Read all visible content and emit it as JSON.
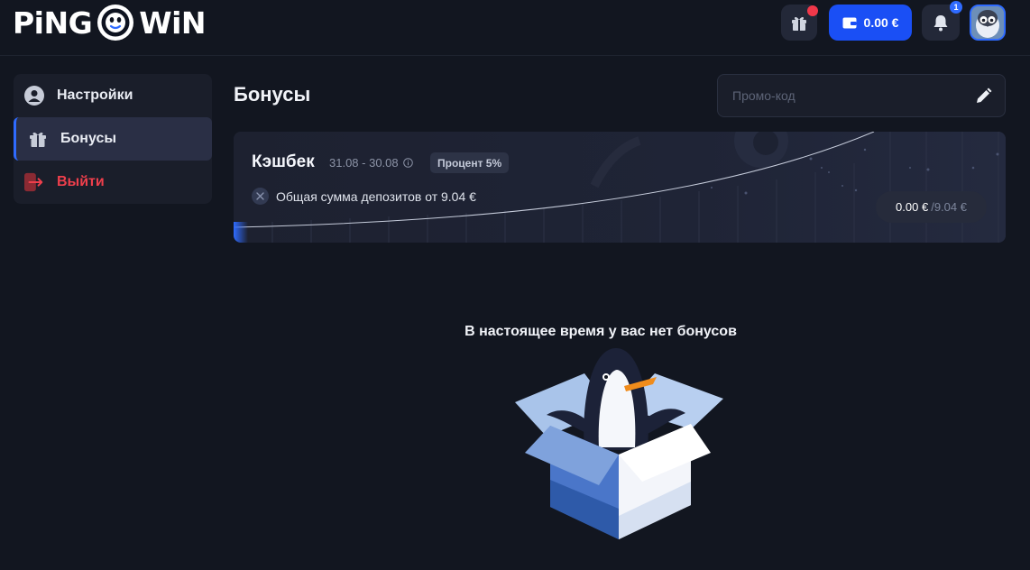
{
  "header": {
    "logo_left": "PiNG",
    "logo_right": "WiN",
    "wallet_balance": "0.00 €",
    "notifications_count": "1",
    "icons": [
      "gift-icon",
      "wallet-icon",
      "bell-icon",
      "avatar"
    ]
  },
  "sidebar": {
    "items": [
      {
        "label": "Настройки",
        "icon": "user-icon",
        "active": false
      },
      {
        "label": "Бонусы",
        "icon": "gift-icon",
        "active": true
      },
      {
        "label": "Выйти",
        "icon": "logout-icon",
        "active": false
      }
    ]
  },
  "main": {
    "title": "Бонусы",
    "promo": {
      "placeholder": "Промо-код",
      "value": ""
    },
    "cashback": {
      "title": "Кэшбек",
      "dates": "31.08 - 30.08",
      "badge": "Процент 5%",
      "condition": "Общая сумма депозитов от 9.04 €",
      "progress_current": "0.00 €",
      "progress_sep": "/",
      "progress_total": "9.04 €",
      "progress_fraction": 0
    },
    "empty_message": "В настоящее время у вас нет бонусов"
  },
  "colors": {
    "background": "#121620",
    "panel": "#1a1e2a",
    "accent_blue": "#1a4ff5",
    "logout_red": "#ee3f4c"
  }
}
